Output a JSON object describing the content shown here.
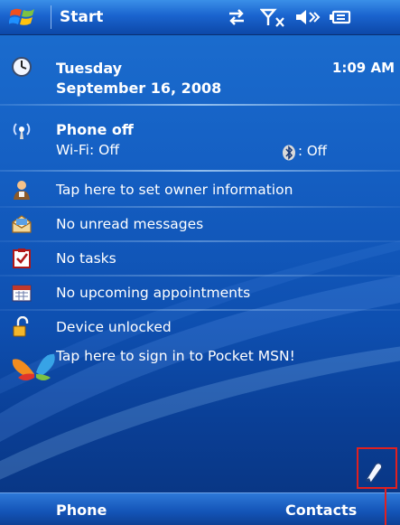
{
  "titlebar": {
    "start_label": "Start",
    "status_icons": [
      "connectivity-icon",
      "signal-off-icon",
      "volume-icon",
      "battery-icon"
    ]
  },
  "today": {
    "date": {
      "weekday": "Tuesday",
      "date": "September 16, 2008",
      "time": "1:09 AM",
      "icon": "clock-icon"
    },
    "wireless": {
      "title": "Phone off",
      "wifi": "Wi-Fi: Off",
      "bluetooth": ": Off",
      "icon": "wireless-icon",
      "bt_icon": "bluetooth-icon"
    },
    "owner": {
      "label": "Tap here to set owner information",
      "icon": "owner-icon"
    },
    "messages": {
      "label": "No unread messages",
      "icon": "envelope-icon"
    },
    "tasks": {
      "label": "No tasks",
      "icon": "tasks-icon"
    },
    "calendar": {
      "label": "No upcoming appointments",
      "icon": "calendar-icon"
    },
    "lock": {
      "label": "Device unlocked",
      "icon": "lock-icon"
    },
    "msn": {
      "label": "Tap here to sign in to Pocket MSN!",
      "icon": "msn-butterfly-icon"
    }
  },
  "tray": {
    "icon": "input-panel-icon"
  },
  "softkeys": {
    "left": "Phone",
    "right": "Contacts"
  },
  "colors": {
    "background": "#1560c4",
    "text": "#ffffff",
    "highlight_box": "#e02020"
  }
}
